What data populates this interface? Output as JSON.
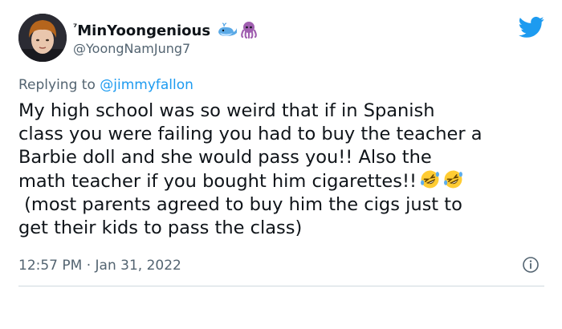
{
  "author": {
    "display_name_prefix": "⁷",
    "display_name": "MinYoongenious",
    "name_emojis": [
      "whale-emoji",
      "octopus-emoji"
    ],
    "handle": "@YoongNamJung7"
  },
  "reply": {
    "prefix": "Replying to",
    "mention": "@jimmyfallon"
  },
  "tweet": {
    "lines": [
      "My high school was so weird that if in Spanish",
      "class you were failing you had to buy the teacher a",
      "Barbie doll and she would pass you!! Also the",
      "math teacher if you bought him cigarettes!!",
      " (most parents agreed to buy him the cigs just to",
      "get their kids to pass the class)"
    ],
    "emoji_after_line_4": [
      "rolling-on-floor-laughing-emoji",
      "rolling-on-floor-laughing-emoji"
    ]
  },
  "meta": {
    "time": "12:57 PM",
    "separator": " · ",
    "date": "Jan 31, 2022"
  },
  "colors": {
    "brand": "#1d9bf0",
    "text": "#0f1419",
    "secondary": "#536471",
    "divider": "#cfd9de"
  }
}
